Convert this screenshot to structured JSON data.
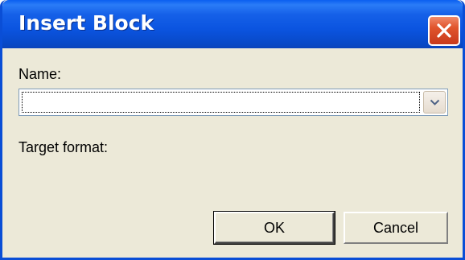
{
  "window": {
    "title": "Insert Block",
    "close_icon": "close-icon"
  },
  "form": {
    "name_label": "Name:",
    "name_value": "",
    "target_format_label": "Target format:"
  },
  "buttons": {
    "ok_label": "OK",
    "cancel_label": "Cancel"
  },
  "colors": {
    "titlebar": "#0a54e0",
    "close_button": "#e0542c",
    "dialog_bg": "#ece9d8"
  }
}
